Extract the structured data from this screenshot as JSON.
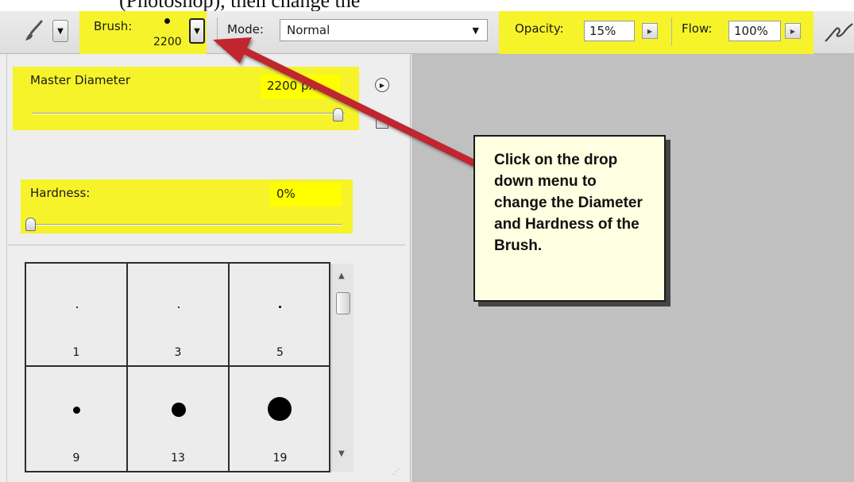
{
  "caption_fragment": "(Photoshop), then change the",
  "toolbar": {
    "brush_label": "Brush:",
    "brush_size": "2200",
    "mode_label": "Mode:",
    "mode_value": "Normal",
    "opacity_label": "Opacity:",
    "opacity_value": "15%",
    "flow_label": "Flow:",
    "flow_value": "100%",
    "icons": [
      "brush-tool-icon",
      "chevron-down-icon",
      "airbrush-icon"
    ]
  },
  "brush_panel": {
    "master_diameter_label": "Master Diameter",
    "master_diameter_value": "2200 px",
    "master_diameter_fraction": 1.0,
    "hardness_label": "Hardness:",
    "hardness_value": "0%",
    "hardness_fraction": 0.0,
    "presets": [
      {
        "size": "1"
      },
      {
        "size": "3"
      },
      {
        "size": "5"
      },
      {
        "size": "9"
      },
      {
        "size": "13"
      },
      {
        "size": "19"
      }
    ]
  },
  "callout": {
    "text": "Click on the drop down menu to change the Diameter and Hardness of the Brush."
  },
  "colors": {
    "highlight": "#f6f32a",
    "arrow": "#c0272d",
    "canvas": "#c0c0c0",
    "callout_bg": "#ffffe1"
  }
}
